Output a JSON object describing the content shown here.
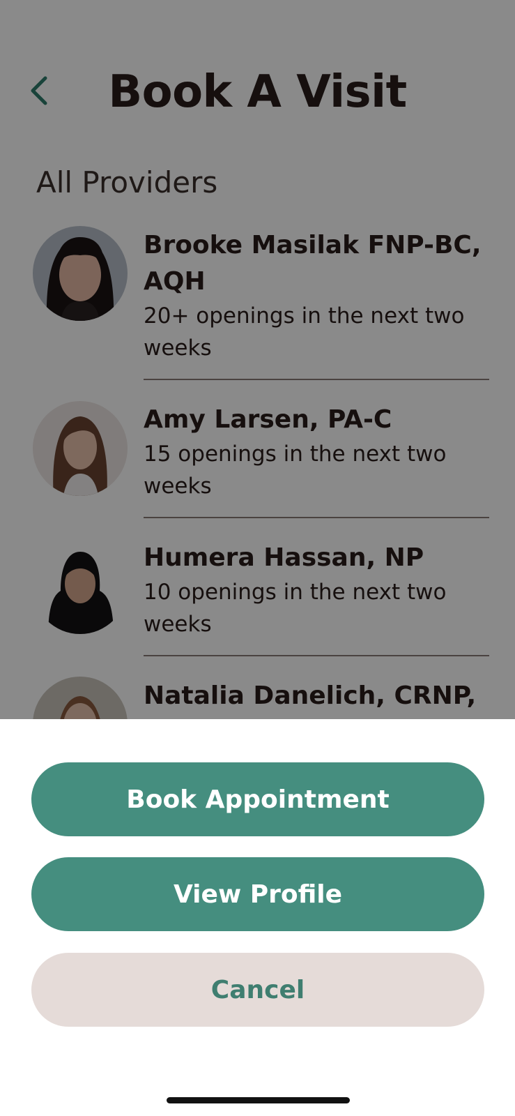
{
  "header": {
    "title": "Book A Visit",
    "back_icon": "chevron-left-icon"
  },
  "section": {
    "title": "All Providers"
  },
  "providers": [
    {
      "name_line1": "Brooke Masilak FNP-BC,",
      "name_line2": "AQH",
      "openings": "20+ openings in the next two weeks"
    },
    {
      "name_line1": "Amy Larsen, PA-C",
      "openings": "15 openings in the next two weeks"
    },
    {
      "name_line1": "Humera Hassan, NP",
      "openings": "10 openings in the next two weeks"
    },
    {
      "name_line1": "Natalia Danelich, CRNP,"
    }
  ],
  "sheet": {
    "book_label": "Book Appointment",
    "profile_label": "View Profile",
    "cancel_label": "Cancel"
  },
  "colors": {
    "accent": "#458e7f",
    "cancel_bg": "#e5dbd8",
    "cancel_text": "#3f7e70",
    "text": "#2a1d1a"
  }
}
